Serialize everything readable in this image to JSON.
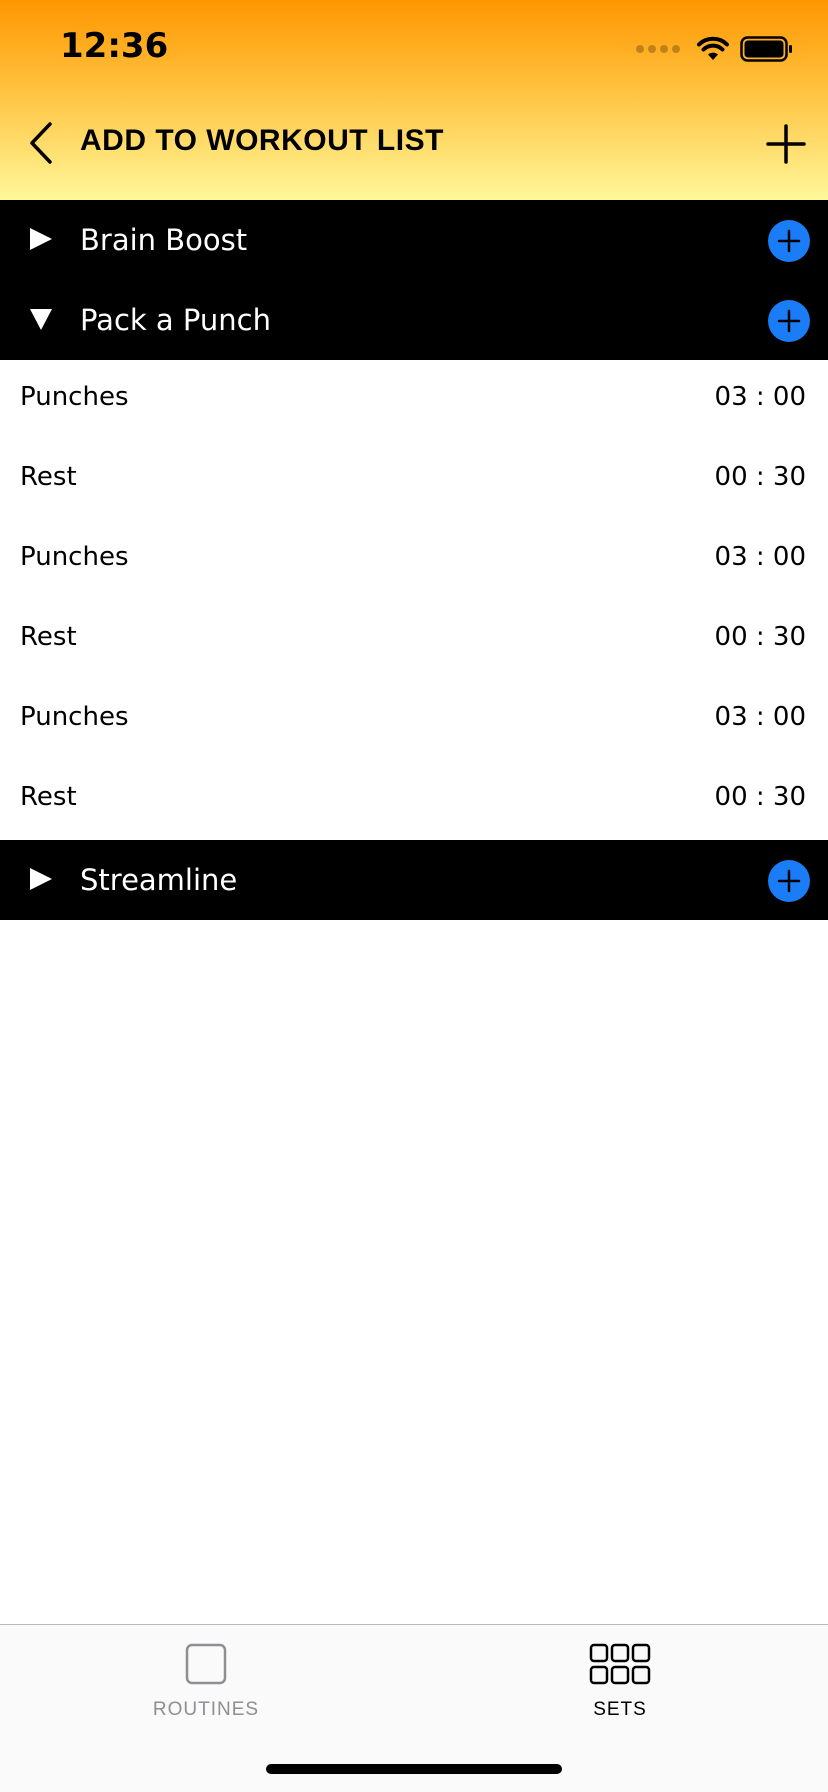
{
  "status_bar": {
    "time": "12:36"
  },
  "nav": {
    "title": "ADD TO WORKOUT LIST"
  },
  "groups": [
    {
      "name": "Brain Boost",
      "expanded": false,
      "items": []
    },
    {
      "name": "Pack a Punch",
      "expanded": true,
      "items": [
        {
          "name": "Punches",
          "time": "03 : 00"
        },
        {
          "name": "Rest",
          "time": "00 : 30"
        },
        {
          "name": "Punches",
          "time": "03 : 00"
        },
        {
          "name": "Rest",
          "time": "00 : 30"
        },
        {
          "name": "Punches",
          "time": "03 : 00"
        },
        {
          "name": "Rest",
          "time": "00 : 30"
        }
      ]
    },
    {
      "name": "Streamline",
      "expanded": false,
      "items": []
    }
  ],
  "tabbar": {
    "routines_label": "ROUTINES",
    "sets_label": "SETS",
    "active_tab": "sets"
  },
  "colors": {
    "accent_blue": "#1a7cf6",
    "header_top": "#ff9600",
    "header_bottom": "#fff79a"
  },
  "icons": {
    "back": "chevron-left-icon",
    "add": "plus-icon",
    "collapsed": "triangle-right-icon",
    "expanded": "triangle-down-icon",
    "group_add": "plus-circle-icon",
    "routines": "square-icon",
    "sets": "grid-icon"
  }
}
